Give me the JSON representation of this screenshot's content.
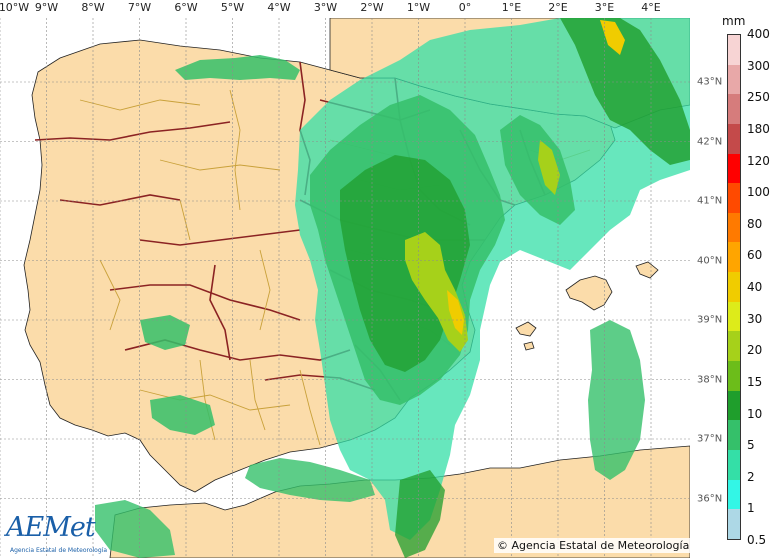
{
  "map": {
    "type": "precipitation-map",
    "longitude_labels": [
      "10°W",
      "9°W",
      "8°W",
      "7°W",
      "6°W",
      "5°W",
      "4°W",
      "3°W",
      "2°W",
      "1°W",
      "0°",
      "1°E",
      "2°E",
      "3°E",
      "4°E"
    ],
    "latitude_labels": [
      "43°N",
      "42°N",
      "41°N",
      "40°N",
      "39°N",
      "38°N",
      "37°N",
      "36°N"
    ],
    "colors": {
      "sea": "#ffffff",
      "land": "#fbdcaa",
      "region_border": "#8b2323",
      "province_border": "#c9a13a",
      "gridline": "#8c8c8c"
    }
  },
  "legend": {
    "unit": "mm",
    "ticks": [
      "400",
      "300",
      "250",
      "180",
      "120",
      "100",
      "80",
      "60",
      "40",
      "30",
      "20",
      "15",
      "10",
      "5",
      "2",
      "1",
      "0.5"
    ],
    "colors": [
      "#f7d4d4",
      "#e8a8a8",
      "#d67c7c",
      "#c44a4a",
      "#ff0000",
      "#ff4a00",
      "#ff7a00",
      "#ffa500",
      "#f0cc00",
      "#ddeb1a",
      "#a6d11a",
      "#6cbd1a",
      "#1f9e2c",
      "#35c06a",
      "#34dfa7",
      "#33f6e6",
      "#add8e6"
    ]
  },
  "logo": {
    "brand": "AEMet",
    "subtitle": "Agencia Estatal de Meteorología"
  },
  "copyright": "© Agencia Estatal de Meteorología"
}
